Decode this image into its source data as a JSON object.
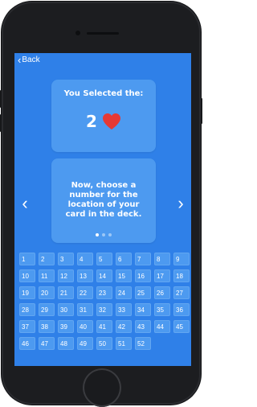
{
  "screen": {
    "back_label": "Back",
    "selected_title": "You Selected the:",
    "selected_value": "2",
    "selected_suit_icon": "heart-icon",
    "instruction": "Now, choose a number for the location of your card in the deck.",
    "page_indicator": {
      "total": 3,
      "active": 0
    },
    "left_arrow": "‹",
    "right_arrow": "›",
    "numbers": [
      "1",
      "2",
      "3",
      "4",
      "5",
      "6",
      "7",
      "8",
      "9",
      "10",
      "11",
      "12",
      "13",
      "14",
      "15",
      "16",
      "17",
      "18",
      "19",
      "20",
      "21",
      "22",
      "23",
      "24",
      "25",
      "26",
      "27",
      "28",
      "29",
      "30",
      "31",
      "32",
      "33",
      "34",
      "35",
      "36",
      "37",
      "38",
      "39",
      "40",
      "41",
      "42",
      "43",
      "44",
      "45",
      "46",
      "47",
      "48",
      "49",
      "50",
      "51",
      "52"
    ]
  },
  "colors": {
    "screen_bg": "#2f80e8",
    "card_bg": "#4d9af0",
    "heart": "#e53935"
  }
}
